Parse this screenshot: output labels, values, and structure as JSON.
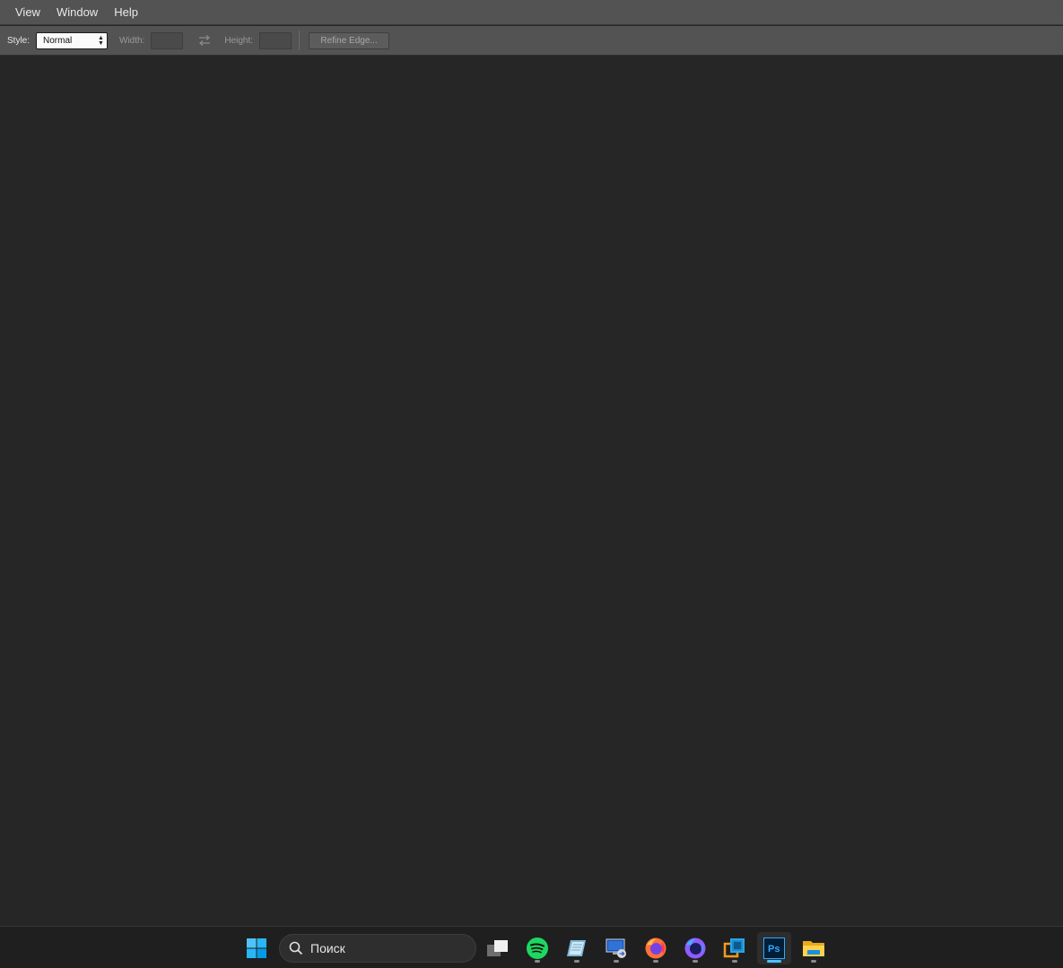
{
  "menubar": {
    "items": [
      "View",
      "Window",
      "Help"
    ]
  },
  "options": {
    "style_label": "Style:",
    "style_value": "Normal",
    "width_label": "Width:",
    "height_label": "Height:",
    "refine_label": "Refine Edge..."
  },
  "taskbar": {
    "search_placeholder": "Поиск",
    "apps": [
      "start-icon",
      "task-view-icon",
      "spotify-icon",
      "notepad-icon",
      "remote-desktop-icon",
      "firefox-icon",
      "firefox-dev-icon",
      "virtualbox-icon",
      "photoshop-icon",
      "file-explorer-icon"
    ],
    "active_app": "photoshop-icon"
  },
  "colors": {
    "menubar_bg": "#535353",
    "workspace_bg": "#262626",
    "taskbar_bg": "#1f1f1f",
    "accent": "#4cc2ff"
  }
}
